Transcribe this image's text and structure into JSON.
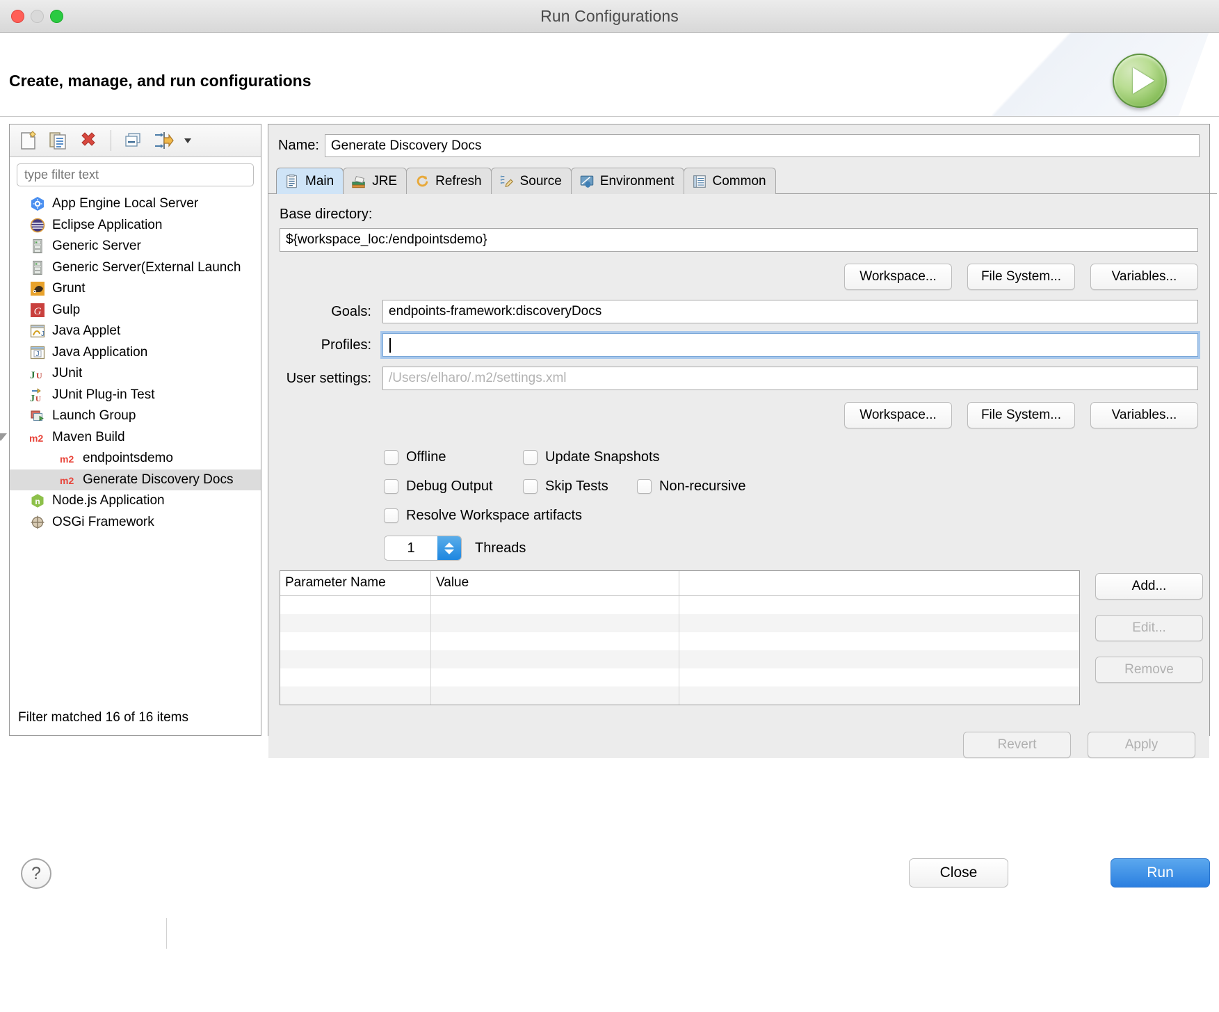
{
  "window": {
    "title": "Run Configurations"
  },
  "header": {
    "title": "Create, manage, and run configurations"
  },
  "tree_toolbar": {
    "new_label": "New launch configuration",
    "duplicate_label": "Duplicate",
    "delete_label": "Delete",
    "collapse_label": "Collapse All",
    "filter_label": "Filter launch configurations"
  },
  "filter": {
    "placeholder": "type filter text",
    "value": ""
  },
  "tree": {
    "items": [
      {
        "label": "App Engine Local Server",
        "icon": "appengine-icon",
        "level": 0,
        "selected": false,
        "expandable": false
      },
      {
        "label": "Eclipse Application",
        "icon": "eclipse-icon",
        "level": 0,
        "selected": false,
        "expandable": false
      },
      {
        "label": "Generic Server",
        "icon": "server-icon",
        "level": 0,
        "selected": false,
        "expandable": false
      },
      {
        "label": "Generic Server(External Launch",
        "icon": "server-icon",
        "level": 0,
        "selected": false,
        "expandable": false
      },
      {
        "label": "Grunt",
        "icon": "grunt-icon",
        "level": 0,
        "selected": false,
        "expandable": false
      },
      {
        "label": "Gulp",
        "icon": "gulp-icon",
        "level": 0,
        "selected": false,
        "expandable": false
      },
      {
        "label": "Java Applet",
        "icon": "java-applet-icon",
        "level": 0,
        "selected": false,
        "expandable": false
      },
      {
        "label": "Java Application",
        "icon": "java-application-icon",
        "level": 0,
        "selected": false,
        "expandable": false
      },
      {
        "label": "JUnit",
        "icon": "junit-icon",
        "level": 0,
        "selected": false,
        "expandable": false
      },
      {
        "label": "JUnit Plug-in Test",
        "icon": "junit-plugin-icon",
        "level": 0,
        "selected": false,
        "expandable": false
      },
      {
        "label": "Launch Group",
        "icon": "launch-group-icon",
        "level": 0,
        "selected": false,
        "expandable": false
      },
      {
        "label": "Maven Build",
        "icon": "maven-icon",
        "level": 0,
        "selected": false,
        "expandable": true
      },
      {
        "label": "endpointsdemo",
        "icon": "maven-icon",
        "level": 1,
        "selected": false,
        "expandable": false
      },
      {
        "label": "Generate Discovery Docs",
        "icon": "maven-icon",
        "level": 1,
        "selected": true,
        "expandable": false
      },
      {
        "label": "Node.js Application",
        "icon": "nodejs-icon",
        "level": 0,
        "selected": false,
        "expandable": false
      },
      {
        "label": "OSGi Framework",
        "icon": "osgi-icon",
        "level": 0,
        "selected": false,
        "expandable": false
      }
    ],
    "status": "Filter matched 16 of 16 items"
  },
  "config": {
    "name_label": "Name:",
    "name_value": "Generate Discovery Docs",
    "tabs": [
      {
        "label": "Main",
        "icon": "main-tab-icon",
        "active": true
      },
      {
        "label": "JRE",
        "icon": "jre-tab-icon",
        "active": false
      },
      {
        "label": "Refresh",
        "icon": "refresh-tab-icon",
        "active": false
      },
      {
        "label": "Source",
        "icon": "source-tab-icon",
        "active": false
      },
      {
        "label": "Environment",
        "icon": "environment-tab-icon",
        "active": false
      },
      {
        "label": "Common",
        "icon": "common-tab-icon",
        "active": false
      }
    ],
    "base_directory": {
      "label": "Base directory:",
      "value": "${workspace_loc:/endpointsdemo}",
      "buttons": [
        "Workspace...",
        "File System...",
        "Variables..."
      ]
    },
    "goals": {
      "label": "Goals:",
      "value": "endpoints-framework:discoveryDocs"
    },
    "profiles": {
      "label": "Profiles:",
      "value": "",
      "focused": true
    },
    "user_settings": {
      "label": "User settings:",
      "value": "",
      "placeholder": "/Users/elharo/.m2/settings.xml",
      "buttons": [
        "Workspace...",
        "File System...",
        "Variables..."
      ]
    },
    "checkboxes": [
      {
        "label": "Offline",
        "checked": false
      },
      {
        "label": "Update Snapshots",
        "checked": false
      },
      {
        "label": "Debug Output",
        "checked": false
      },
      {
        "label": "Skip Tests",
        "checked": false
      },
      {
        "label": "Non-recursive",
        "checked": false
      },
      {
        "label": "Resolve Workspace artifacts",
        "checked": false
      }
    ],
    "threads": {
      "value": "1",
      "label": "Threads"
    },
    "parameters": {
      "columns": [
        "Parameter Name",
        "Value",
        ""
      ],
      "rows": [],
      "empty_row_count": 5,
      "buttons": [
        {
          "label": "Add...",
          "enabled": true
        },
        {
          "label": "Edit...",
          "enabled": false
        },
        {
          "label": "Remove",
          "enabled": false
        }
      ]
    },
    "footer_buttons": [
      {
        "label": "Revert",
        "enabled": false
      },
      {
        "label": "Apply",
        "enabled": false
      }
    ]
  },
  "dialog_buttons": {
    "help": "?",
    "close": "Close",
    "run": "Run"
  },
  "colors": {
    "accent": "#2b7fe0",
    "active_tab": "#cfe4f7",
    "selection": "#dcdcdc",
    "focus_ring": "#a8c8ec",
    "run_green": "#83bb55",
    "maven_red": "#e8443a"
  }
}
